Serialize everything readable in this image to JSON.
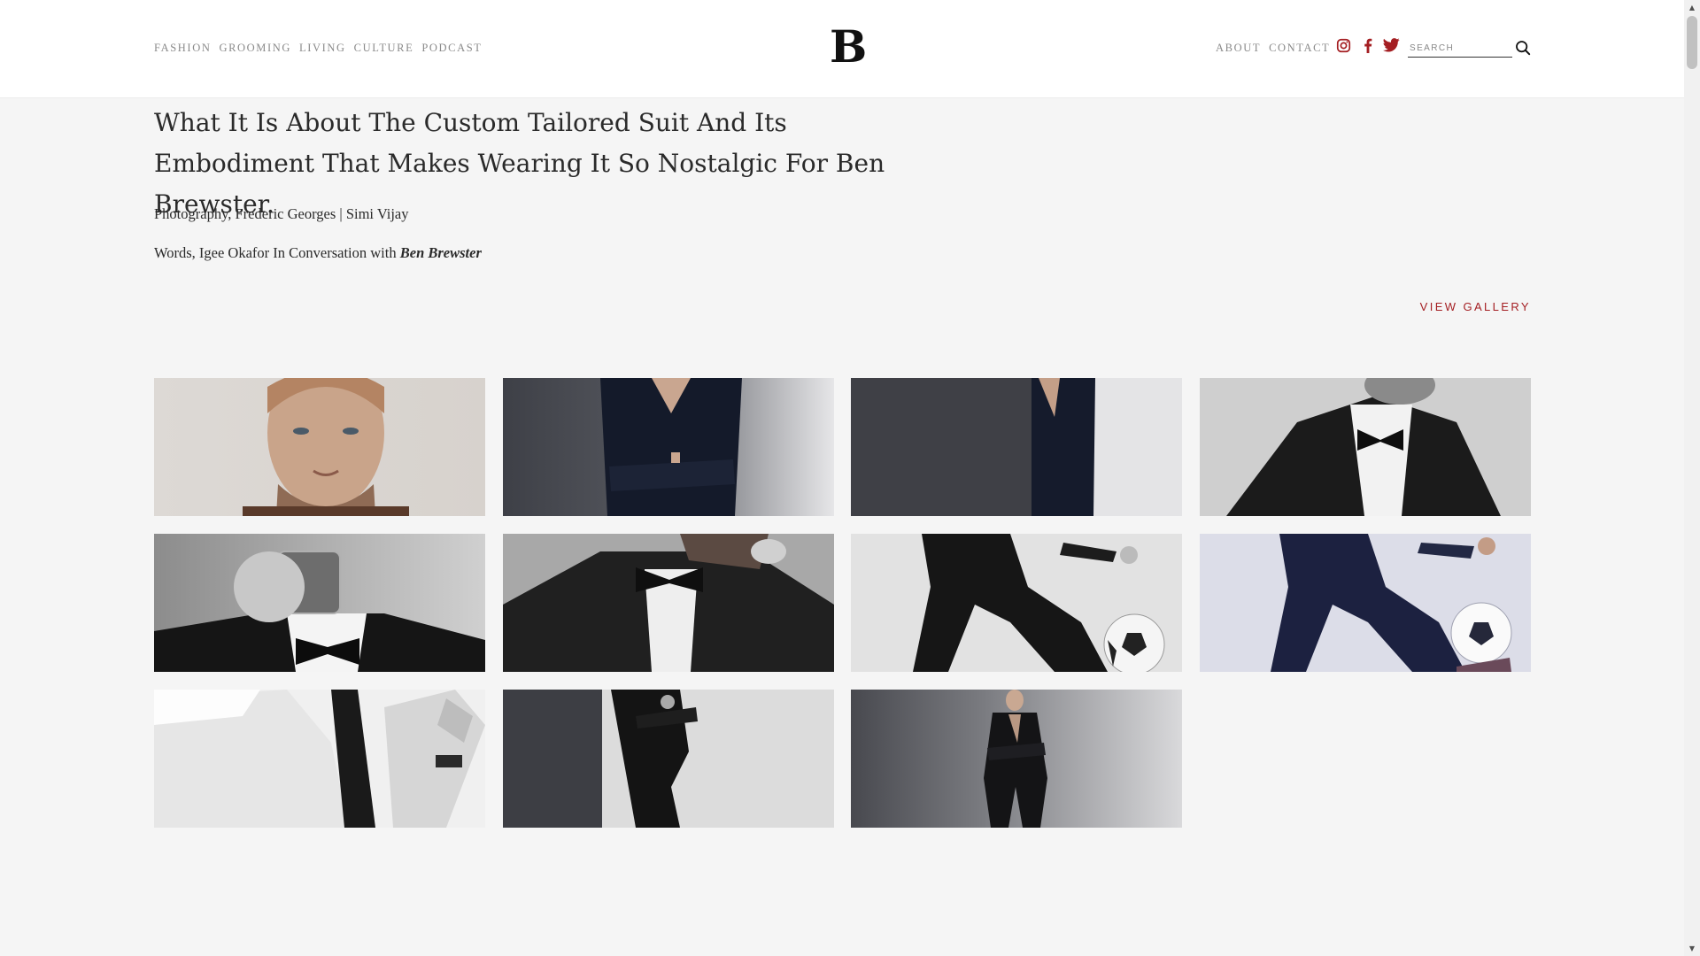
{
  "site": {
    "logo": "B",
    "nav_left": [
      "FASHION",
      "GROOMING",
      "LIVING",
      "CULTURE",
      "PODCAST"
    ],
    "nav_right": [
      "ABOUT",
      "CONTACT"
    ],
    "social_icons": [
      "instagram-icon",
      "facebook-icon",
      "twitter-icon"
    ],
    "search_placeholder": "SEARCH",
    "accent_color": "#a41e22"
  },
  "article": {
    "title": "What It Is About The Custom Tailored Suit And Its Embodiment That Makes Wearing It So Nostalgic For Ben Brewster.",
    "photography_credit": "Photography, Frederic Georges | Simi Vijay",
    "words_credit_prefix": "Words, Igee Okafor In Conversation with ",
    "words_credit_name": "Ben Brewster",
    "view_gallery": "VIEW GALLERY"
  },
  "gallery": {
    "images": [
      "portrait-closeup",
      "crossed-arms-suit",
      "half-shadow-suit",
      "bow-tie-tuxedo",
      "drinking-whiskey",
      "adjusting-bow-tie",
      "kicking-football-bw",
      "kicking-football-color",
      "white-shirt-sleeve",
      "leaning-wall",
      "standing-full-length"
    ]
  }
}
